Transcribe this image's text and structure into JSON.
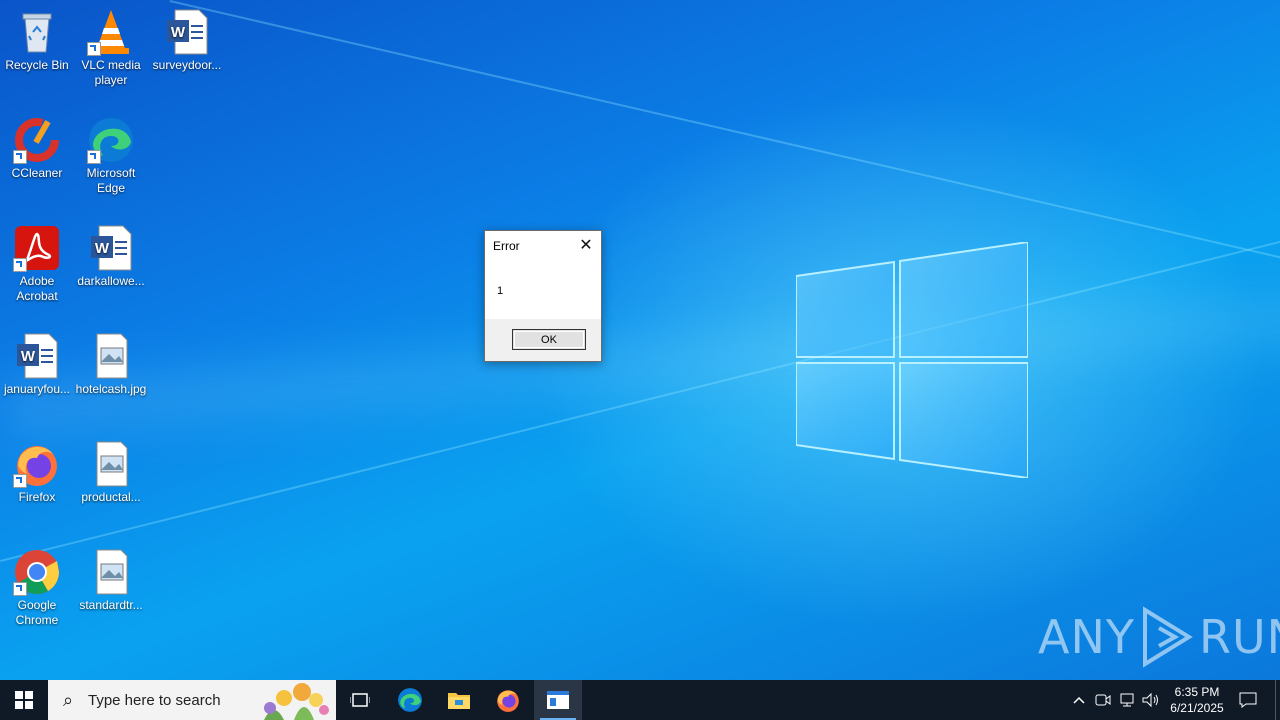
{
  "desktop": {
    "icons": [
      {
        "label": "Recycle Bin",
        "icon": "recycle-bin-icon"
      },
      {
        "label": "VLC media player",
        "icon": "vlc-icon"
      },
      {
        "label": "surveydoor...",
        "icon": "word-doc-icon"
      },
      {
        "label": "CCleaner",
        "icon": "ccleaner-icon"
      },
      {
        "label": "Microsoft Edge",
        "icon": "edge-icon"
      },
      {
        "label": "Adobe Acrobat",
        "icon": "acrobat-icon"
      },
      {
        "label": "darkallowe...",
        "icon": "word-doc-icon"
      },
      {
        "label": "januaryfou...",
        "icon": "word-doc-icon"
      },
      {
        "label": "hotelcash.jpg",
        "icon": "image-file-icon"
      },
      {
        "label": "Firefox",
        "icon": "firefox-icon"
      },
      {
        "label": "productal...",
        "icon": "image-file-icon"
      },
      {
        "label": "Google Chrome",
        "icon": "chrome-icon"
      },
      {
        "label": "standardtr...",
        "icon": "image-file-icon"
      }
    ]
  },
  "dialog": {
    "title": "Error",
    "message": "1",
    "ok_label": "OK"
  },
  "watermark": {
    "left": "ANY",
    "right": "RUN"
  },
  "taskbar": {
    "search_placeholder": "Type here to search",
    "pinned": [
      "start-icon",
      "task-view-icon",
      "edge-icon",
      "file-explorer-icon",
      "firefox-icon",
      "active-app-icon"
    ],
    "clock_time": "6:35 PM",
    "clock_date": "6/21/2025"
  },
  "colors": {
    "taskbar": "#101a26",
    "accent": "#0b7ee6"
  }
}
